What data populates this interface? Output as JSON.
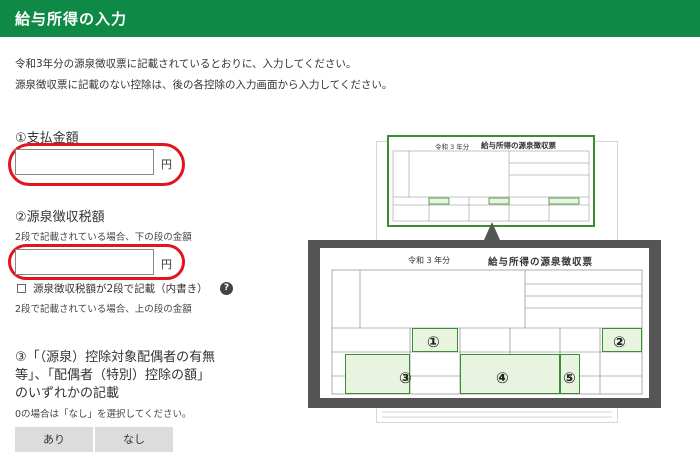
{
  "header": {
    "title": "給与所得の入力"
  },
  "intro": {
    "line1": "令和3年分の源泉徴収票に記載されているとおりに、入力してください。",
    "line2": "源泉徴収票に記載のない控除は、後の各控除の入力画面から入力してください。"
  },
  "q1": {
    "label": "①支払金額",
    "value": "",
    "unit": "円"
  },
  "q2": {
    "label": "②源泉徴収税額",
    "note": "2段で記載されている場合、下の段の金額",
    "value": "",
    "unit": "円",
    "checkbox_label": "源泉徴収税額が2段で記載（内書き）",
    "checkbox_checked": false,
    "checkbox_note": "2段で記載されている場合、上の段の金額",
    "help": "?"
  },
  "q3": {
    "label_line1": "③「（源泉）控除対象配偶者の有無",
    "label_line2": "等」、「配偶者（特別）控除の額」",
    "label_line3": "のいずれかの記載",
    "note": "0の場合は「なし」を選択してください。",
    "option_yes": "あり",
    "option_no": "なし"
  },
  "illustration": {
    "small_year": "令和 3 年分",
    "small_title": "給与所得の源泉徴収票",
    "zoom_year": "令和 3 年分",
    "zoom_title": "給与所得の源泉徴収票",
    "marker1": "①",
    "marker2": "②",
    "marker3": "③",
    "marker4": "④",
    "marker5": "⑤"
  },
  "colors": {
    "header_bg": "#0f8a46",
    "highlight_oval": "#e2141d",
    "form_green": "#3a8e32"
  }
}
